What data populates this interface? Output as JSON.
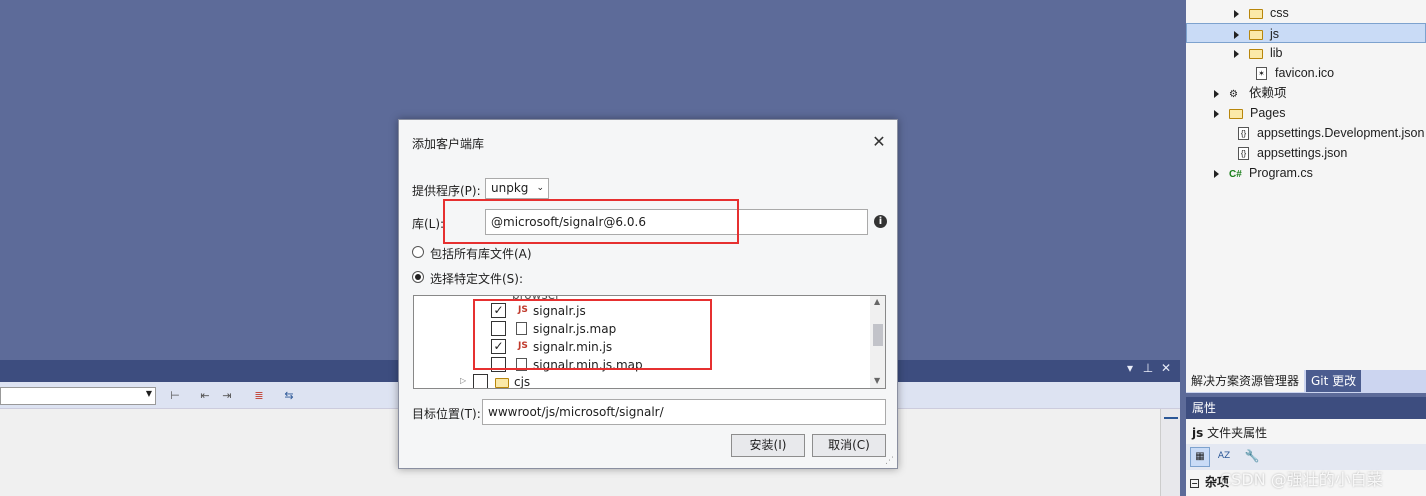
{
  "solution_explorer": {
    "items": [
      {
        "label": "css",
        "kind": "folder",
        "expand": true
      },
      {
        "label": "js",
        "kind": "folder",
        "expand": true,
        "selected": true
      },
      {
        "label": "lib",
        "kind": "folder",
        "expand": true
      },
      {
        "label": "favicon.ico",
        "kind": "file-icon",
        "expand": false
      },
      {
        "label": "依赖项",
        "kind": "deps",
        "expand": true
      },
      {
        "label": "Pages",
        "kind": "folder",
        "expand": true
      },
      {
        "label": "appsettings.Development.json",
        "kind": "json",
        "expand": false
      },
      {
        "label": "appsettings.json",
        "kind": "json",
        "expand": false
      },
      {
        "label": "Program.cs",
        "kind": "csharp",
        "expand": true
      }
    ],
    "tabs": [
      "解决方案资源管理器",
      "Git 更改"
    ]
  },
  "properties": {
    "title": "属性",
    "subject_name": "js",
    "subject_type": "文件夹属性",
    "category": "杂项"
  },
  "dialog": {
    "title": "添加客户端库",
    "provider_label": "提供程序(P):",
    "provider_value": "unpkg",
    "library_label": "库(L):",
    "library_value": "@microsoft/signalr@6.0.6",
    "radio_all": "包括所有库文件(A)",
    "radio_specific": "选择特定文件(S):",
    "tree": {
      "partial_top": "browser",
      "files": [
        {
          "name": "signalr.js",
          "checked": true,
          "icon": "JS"
        },
        {
          "name": "signalr.js.map",
          "checked": false,
          "icon": "file"
        },
        {
          "name": "signalr.min.js",
          "checked": true,
          "icon": "JS"
        },
        {
          "name": "signalr.min.js.map",
          "checked": false,
          "icon": "file"
        }
      ],
      "partial_bottom": "cjs"
    },
    "target_label": "目标位置(T):",
    "target_value": "wwwroot/js/microsoft/signalr/",
    "install_button": "安装(I)",
    "cancel_button": "取消(C)"
  },
  "watermark": "CSDN @强壮的小白菜"
}
